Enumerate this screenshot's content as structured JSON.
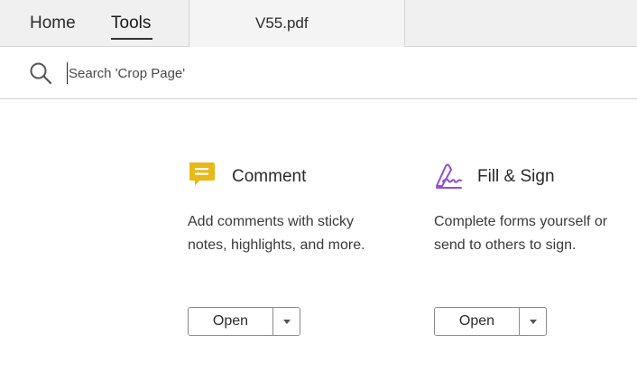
{
  "tabs": {
    "home_label": "Home",
    "tools_label": "Tools",
    "document_label": "V55.pdf"
  },
  "search": {
    "placeholder": "Search 'Crop Page'",
    "icon": "search-icon"
  },
  "tools": [
    {
      "title": "Comment",
      "description": "Add comments with sticky notes, highlights, and more.",
      "open_label": "Open",
      "icon": "comment-icon",
      "icon_color": "#e8b919"
    },
    {
      "title": "Fill & Sign",
      "description": "Complete forms yourself or send to others to sign.",
      "open_label": "Open",
      "icon": "fill-sign-icon",
      "icon_color": "#8f4fd6"
    }
  ]
}
